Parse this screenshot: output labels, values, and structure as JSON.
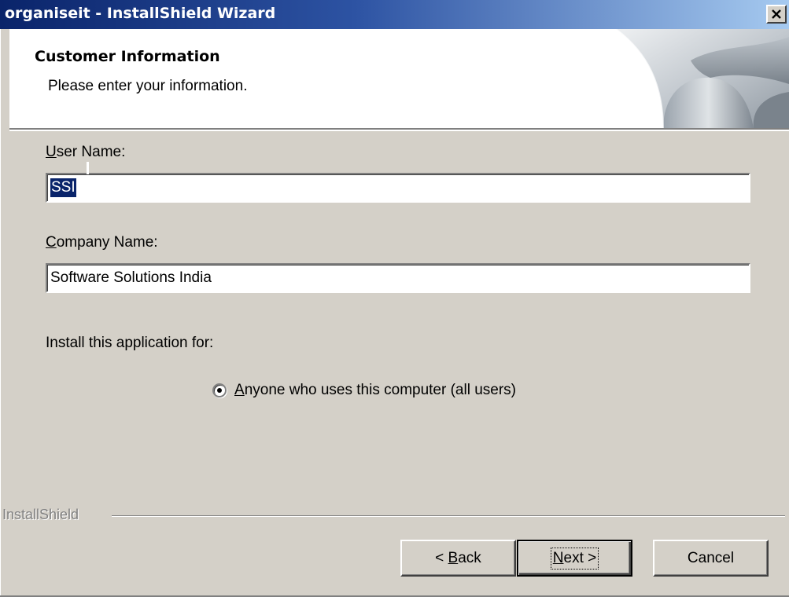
{
  "window": {
    "title": "organiseit - InstallShield Wizard",
    "close_symbol": "×"
  },
  "header": {
    "title": "Customer Information",
    "subtitle": "Please enter your information."
  },
  "form": {
    "user_name_label_accel": "U",
    "user_name_label_rest": "ser Name:",
    "user_name_value": "SSI",
    "company_name_label_accel": "C",
    "company_name_label_rest": "ompany Name:",
    "company_name_value": "Software Solutions India",
    "install_for_label": "Install this application for:",
    "radio_all_users_accel": "A",
    "radio_all_users_rest": "nyone who uses this computer (all users)",
    "radio_all_users_selected": true
  },
  "branding": {
    "text": "InstallShield"
  },
  "buttons": {
    "back_prefix": "< ",
    "back_accel": "B",
    "back_rest": "ack",
    "next_accel": "N",
    "next_rest": "ext >",
    "cancel": "Cancel"
  },
  "colors": {
    "titlebar_start": "#0a246a",
    "titlebar_end": "#a6caf0",
    "dialog_face": "#d4d0c8",
    "selection": "#0a246a"
  }
}
